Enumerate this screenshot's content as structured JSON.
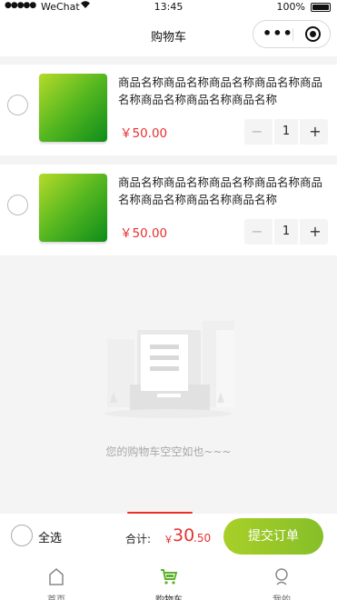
{
  "status_bar": {
    "signal": "●●●●●",
    "carrier": "WeChat",
    "time": "13:45",
    "battery": "100%"
  },
  "nav": {
    "title": "购物车",
    "more_icon": "more-dots-icon",
    "close_icon": "target-icon"
  },
  "cart": {
    "items": [
      {
        "name": "商品名称商品名称商品名称商品名称商品名称商品名称商品名称商品名称",
        "price": "￥50.00",
        "quantity": "1",
        "minus": "−",
        "plus": "+"
      },
      {
        "name": "商品名称商品名称商品名称商品名称商品名称商品名称商品名称商品名称",
        "price": "￥50.00",
        "quantity": "1",
        "minus": "−",
        "plus": "+"
      }
    ]
  },
  "empty_state": {
    "text": "您的购物车空空如也~~~"
  },
  "checkout": {
    "select_all": "全选",
    "total_label": "合计:",
    "currency": "￥",
    "total_int": "30",
    "total_dec": ".50",
    "submit": "提交订单"
  },
  "tabs": [
    {
      "label": "首页",
      "icon": "home-icon"
    },
    {
      "label": "购物车",
      "icon": "cart-icon"
    },
    {
      "label": "我的",
      "icon": "user-icon"
    }
  ],
  "colors": {
    "accent_green": "#8fc22a",
    "price_red": "#e8302f",
    "background": "#f4f4f4"
  }
}
